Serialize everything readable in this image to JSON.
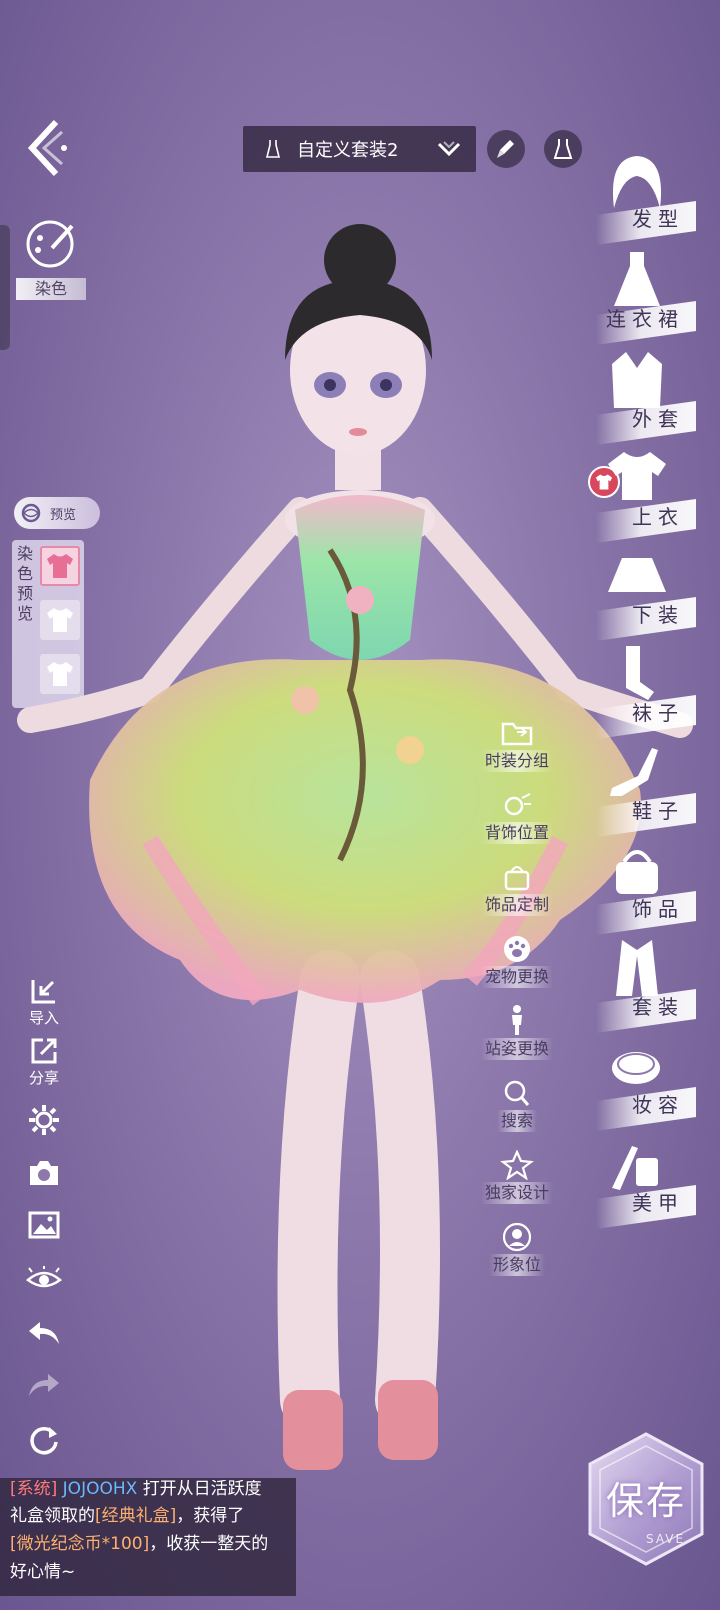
{
  "top_bar": {
    "outfit_name": "自定义套装2",
    "icons": [
      "back-arrow-icon",
      "dress-icon",
      "chevron-down-icon",
      "brush-icon",
      "dress-outline-icon"
    ]
  },
  "left_panel": {
    "dye_label": "染色",
    "preview_label": "预览",
    "dye_preview_label": "染色预览",
    "tools": [
      {
        "label": "导入",
        "icon": "import-icon"
      },
      {
        "label": "分享",
        "icon": "share-icon"
      },
      {
        "label": "",
        "icon": "settings-icon"
      },
      {
        "label": "",
        "icon": "camera-icon"
      },
      {
        "label": "",
        "icon": "image-icon"
      },
      {
        "label": "",
        "icon": "eye-icon"
      },
      {
        "label": "",
        "icon": "undo-icon"
      },
      {
        "label": "",
        "icon": "redo-icon"
      },
      {
        "label": "",
        "icon": "reset-icon"
      }
    ]
  },
  "middle_menu": {
    "items": [
      {
        "label": "时装分组",
        "icon": "folder-icon"
      },
      {
        "label": "背饰位置",
        "icon": "back-accessory-icon"
      },
      {
        "label": "饰品定制",
        "icon": "bag-icon"
      },
      {
        "label": "宠物更换",
        "icon": "paw-icon"
      },
      {
        "label": "站姿更换",
        "icon": "stand-pose-icon"
      },
      {
        "label": "搜索",
        "icon": "search-icon"
      },
      {
        "label": "独家设计",
        "icon": "star-icon"
      },
      {
        "label": "形象位",
        "icon": "profile-icon"
      }
    ]
  },
  "categories": [
    {
      "label": "发型",
      "icon": "hair-icon"
    },
    {
      "label": "连衣裙",
      "icon": "dress-icon"
    },
    {
      "label": "外套",
      "icon": "coat-icon"
    },
    {
      "label": "上衣",
      "icon": "top-icon"
    },
    {
      "label": "下装",
      "icon": "skirt-icon"
    },
    {
      "label": "袜子",
      "icon": "socks-icon"
    },
    {
      "label": "鞋子",
      "icon": "shoe-icon"
    },
    {
      "label": "饰品",
      "icon": "accessory-icon"
    },
    {
      "label": "套装",
      "icon": "suit-icon"
    },
    {
      "label": "妆容",
      "icon": "makeup-icon"
    },
    {
      "label": "美甲",
      "icon": "nail-icon"
    }
  ],
  "chat": {
    "line1_tag": "[系统]",
    "line1_user": "JOJOOHX",
    "line1_rest": "打开从日活跃度",
    "line2_prefix": "礼盒领取的",
    "line2_item": "[经典礼盒]",
    "line2_suffix": "，获得了",
    "line3_item": "[微光纪念币*100]",
    "line3_suffix": "，收获一整天的",
    "line4": "好心情~"
  },
  "save": {
    "label": "保存",
    "sub_label": "SAVE"
  },
  "colors": {
    "background": "#8c78ab",
    "accent_red": "#d7485e",
    "text_dark": "#4a3c62",
    "chat_highlight": "#ffb070"
  }
}
